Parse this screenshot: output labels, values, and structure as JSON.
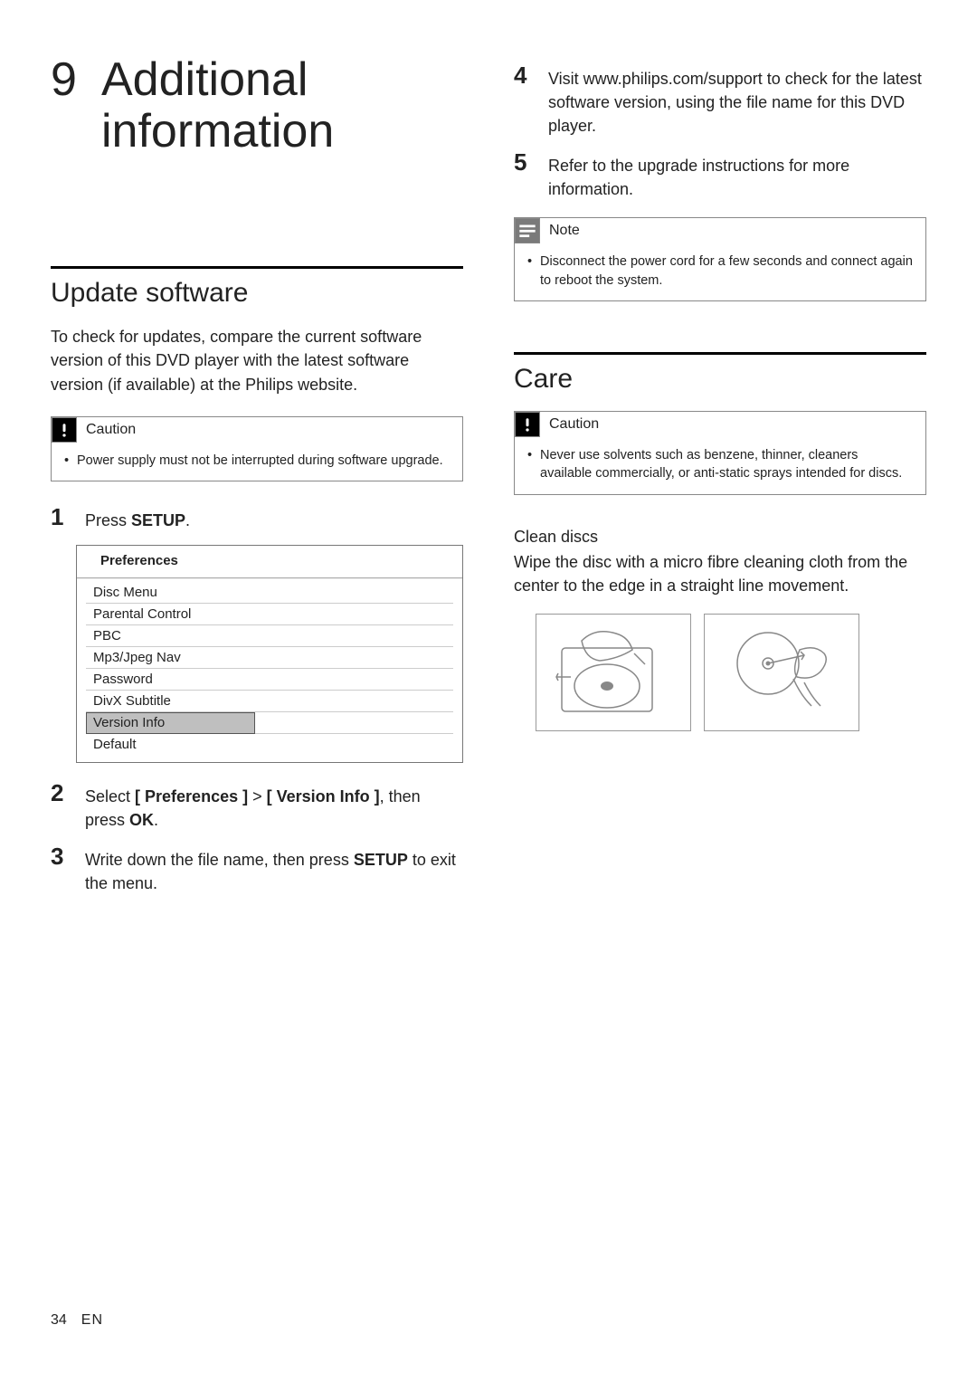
{
  "chapter": {
    "number": "9",
    "title": "Additional information"
  },
  "left": {
    "section_title": "Update software",
    "intro": "To check for updates, compare the current software version of this DVD player with the latest software version (if available) at the Philips website.",
    "caution": {
      "label": "Caution",
      "item": "Power supply must not be interrupted during software upgrade."
    },
    "step1": {
      "num": "1",
      "pre": "Press ",
      "bold": "SETUP",
      "post": "."
    },
    "menu": {
      "header": "Preferences",
      "items": [
        "Disc Menu",
        "Parental Control",
        "PBC",
        "Mp3/Jpeg Nav",
        "Password",
        "DivX Subtitle",
        "Version Info",
        "Default"
      ],
      "selected_index": 6
    },
    "step2": {
      "num": "2",
      "t1": "Select ",
      "b1": "[ Preferences ]",
      "t2": " > ",
      "b2": "[ Version Info ]",
      "t3": ", then press ",
      "b3": "OK",
      "t4": "."
    },
    "step3": {
      "num": "3",
      "t1": "Write down the file name, then press ",
      "b1": "SETUP",
      "t2": " to exit the menu."
    }
  },
  "right": {
    "step4": {
      "num": "4",
      "text": "Visit www.philips.com/support to check for the latest software version, using the file name for this DVD player."
    },
    "step5": {
      "num": "5",
      "text": "Refer to the upgrade instructions for more information."
    },
    "note": {
      "label": "Note",
      "item": "Disconnect the power cord for a few seconds and connect again to reboot the system."
    },
    "care_title": "Care",
    "caution": {
      "label": "Caution",
      "item": "Never use solvents such as benzene, thinner, cleaners available commercially, or anti-static sprays intended for discs."
    },
    "clean_head": "Clean discs",
    "clean_body": "Wipe the disc with a micro fibre cleaning cloth from the center to the edge in a straight line movement."
  },
  "footer": {
    "page": "34",
    "lang": "EN"
  }
}
